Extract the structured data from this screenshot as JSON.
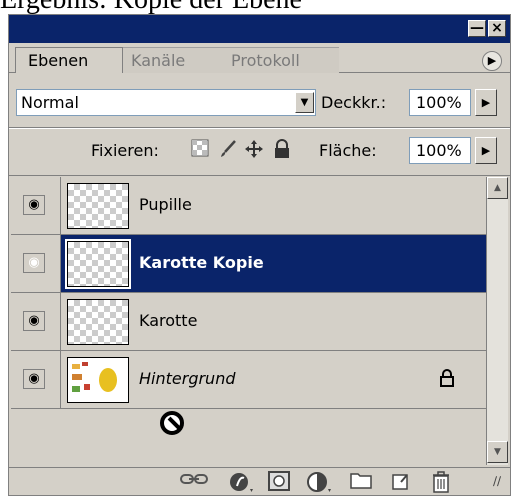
{
  "caption": "Ergebnis: Kopie der Ebene",
  "window": {
    "minimize_label": "—",
    "close_label": "×"
  },
  "tabs": [
    {
      "label": "Ebenen",
      "active": true
    },
    {
      "label": "Kanäle",
      "active": false
    },
    {
      "label": "Protokoll",
      "active": false
    }
  ],
  "panel_menu_icon": "triangle-right",
  "blend_mode": {
    "value": "Normal"
  },
  "opacity": {
    "label": "Deckkr.:",
    "value": "100%"
  },
  "lock": {
    "label": "Fixieren:",
    "icons": [
      "transparency-lock-icon",
      "brush-lock-icon",
      "move-lock-icon",
      "padlock-icon"
    ]
  },
  "fill": {
    "label": "Fläche:",
    "value": "100%"
  },
  "layers": [
    {
      "name": "Pupille",
      "visible": true,
      "selected": false,
      "locked": false
    },
    {
      "name": "Karotte Kopie",
      "visible": true,
      "selected": true,
      "locked": false
    },
    {
      "name": "Karotte",
      "visible": true,
      "selected": false,
      "locked": false
    },
    {
      "name": "Hintergrund",
      "visible": true,
      "selected": false,
      "locked": true
    }
  ],
  "colors": {
    "selection": "#0a246a",
    "panel": "#d4d0c8"
  },
  "bottom_icons": [
    "link-icon",
    "layer-style-icon",
    "mask-icon",
    "adjustment-layer-icon",
    "folder-icon",
    "new-layer-icon",
    "trash-icon"
  ]
}
